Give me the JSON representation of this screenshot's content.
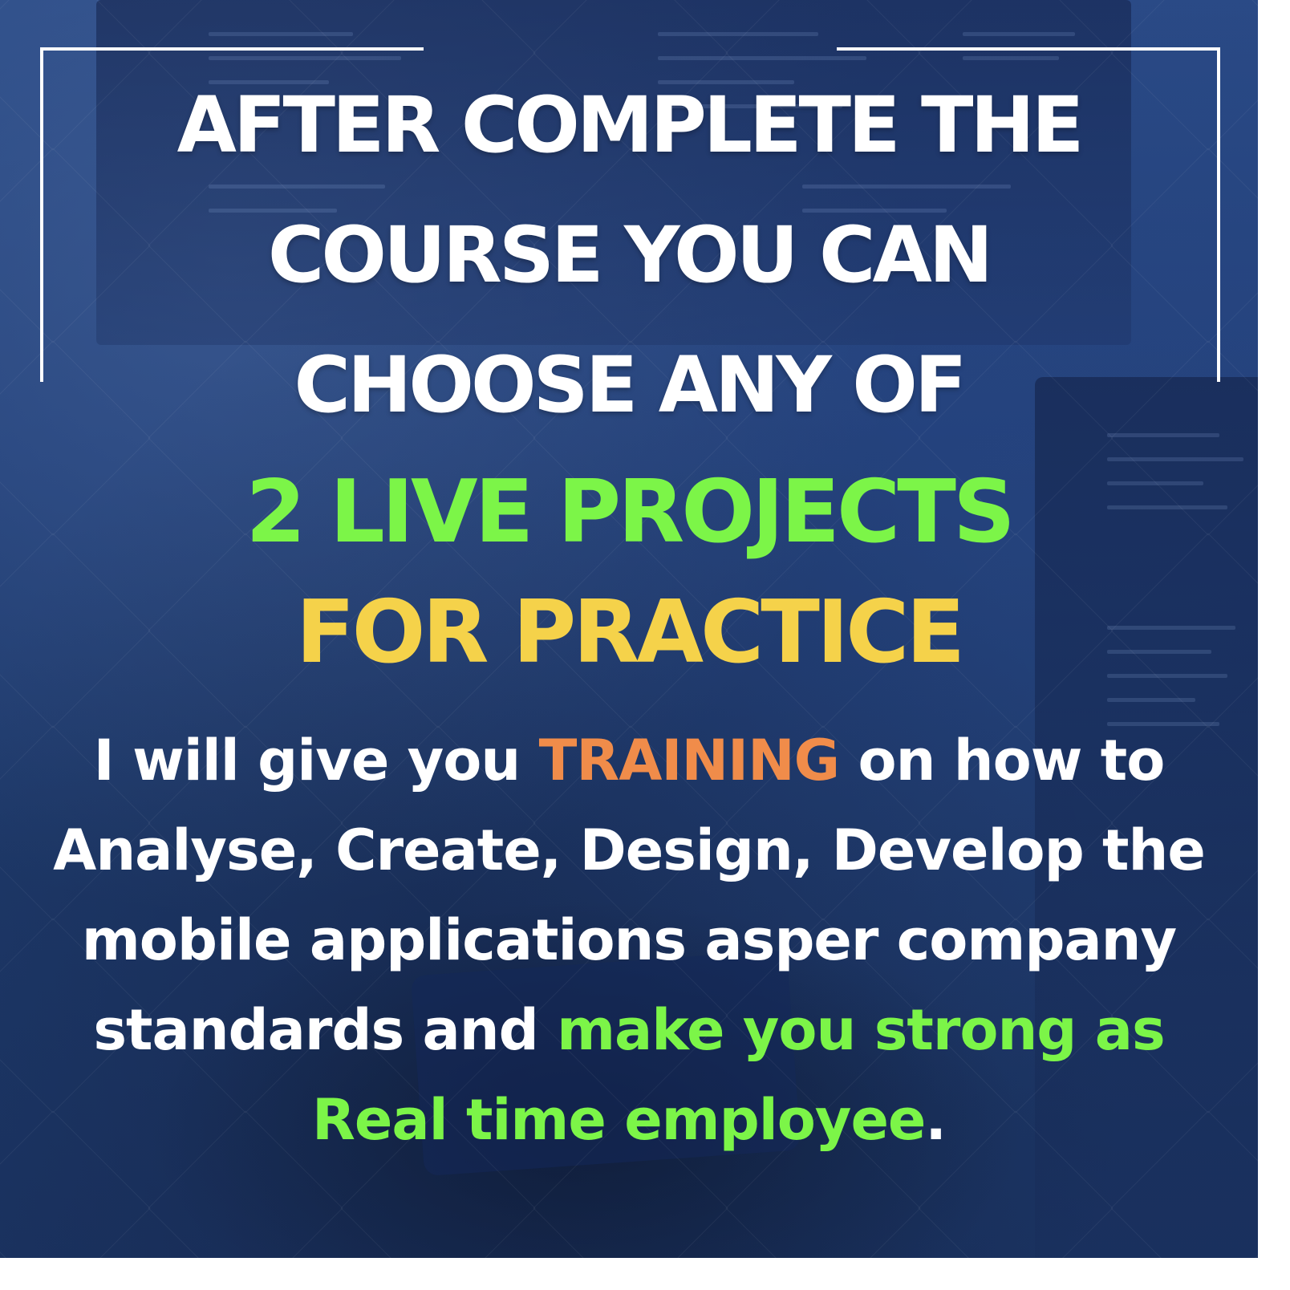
{
  "headline": {
    "line1": "AFTER COMPLETE THE",
    "line2": "COURSE YOU CAN",
    "line3": "CHOOSE ANY OF"
  },
  "highlight": {
    "projects": "2 LIVE PROJECTS",
    "practice": "FOR PRACTICE"
  },
  "body": {
    "line1_a": "I will give you ",
    "line1_emphasis": "TRAINING",
    "line1_b": " on how to",
    "line2": "Analyse, Create, Design, Develop the",
    "line3": "mobile applications asper company",
    "line4_a": "standards and ",
    "line4_emphasis": "make you strong as",
    "line5_emphasis": "Real time employee",
    "line5_b": "."
  },
  "colors": {
    "headline": "#ffffff",
    "green": "#7cf548",
    "yellow": "#f5d24a",
    "orange": "#f08c4a",
    "background": "#22407a"
  }
}
